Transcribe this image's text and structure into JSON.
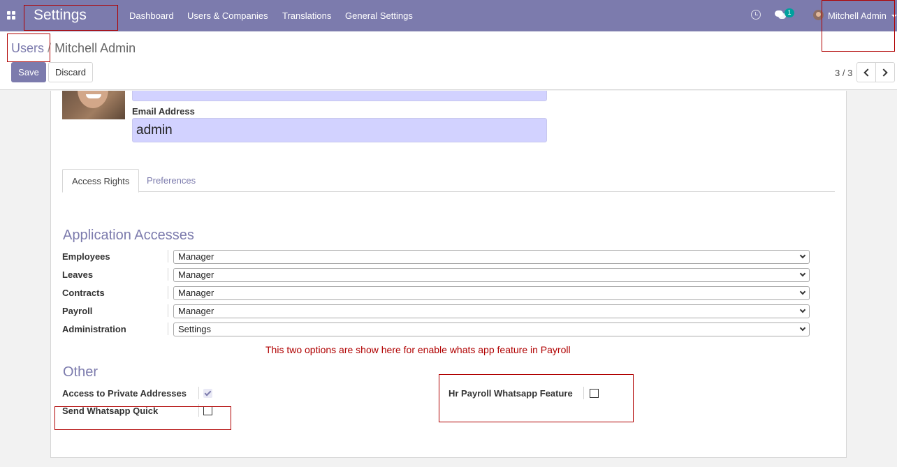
{
  "navbar": {
    "app_title": "Settings",
    "menu": [
      "Dashboard",
      "Users & Companies",
      "Translations",
      "General Settings"
    ],
    "chat_count": "1",
    "user_name": "Mitchell Admin",
    "color": "#7c7bad"
  },
  "breadcrumb": {
    "parent": "Users",
    "separator": "/",
    "current": "Mitchell Admin"
  },
  "buttons": {
    "save": "Save",
    "discard": "Discard"
  },
  "pager": {
    "value": "3 / 3"
  },
  "form": {
    "name_value": "Mitchell Admin",
    "email_label": "Email Address",
    "email_value": "admin"
  },
  "tabs": [
    "Access Rights",
    "Preferences"
  ],
  "application_accesses": {
    "title": "Application Accesses",
    "fields": [
      {
        "label": "Employees",
        "value": "Manager"
      },
      {
        "label": "Leaves",
        "value": "Manager"
      },
      {
        "label": "Contracts",
        "value": "Manager"
      },
      {
        "label": "Payroll",
        "value": "Manager"
      },
      {
        "label": "Administration",
        "value": "Settings"
      }
    ]
  },
  "note": "This two options are show here for enable whats app feature in Payroll",
  "other": {
    "title": "Other",
    "access_private_label": "Access to Private Addresses",
    "access_private_checked": true,
    "send_whatsapp_label": "Send Whatsapp Quick",
    "send_whatsapp_checked": false,
    "hr_payroll_whatsapp_label": "Hr Payroll Whatsapp Feature",
    "hr_payroll_whatsapp_checked": false
  }
}
